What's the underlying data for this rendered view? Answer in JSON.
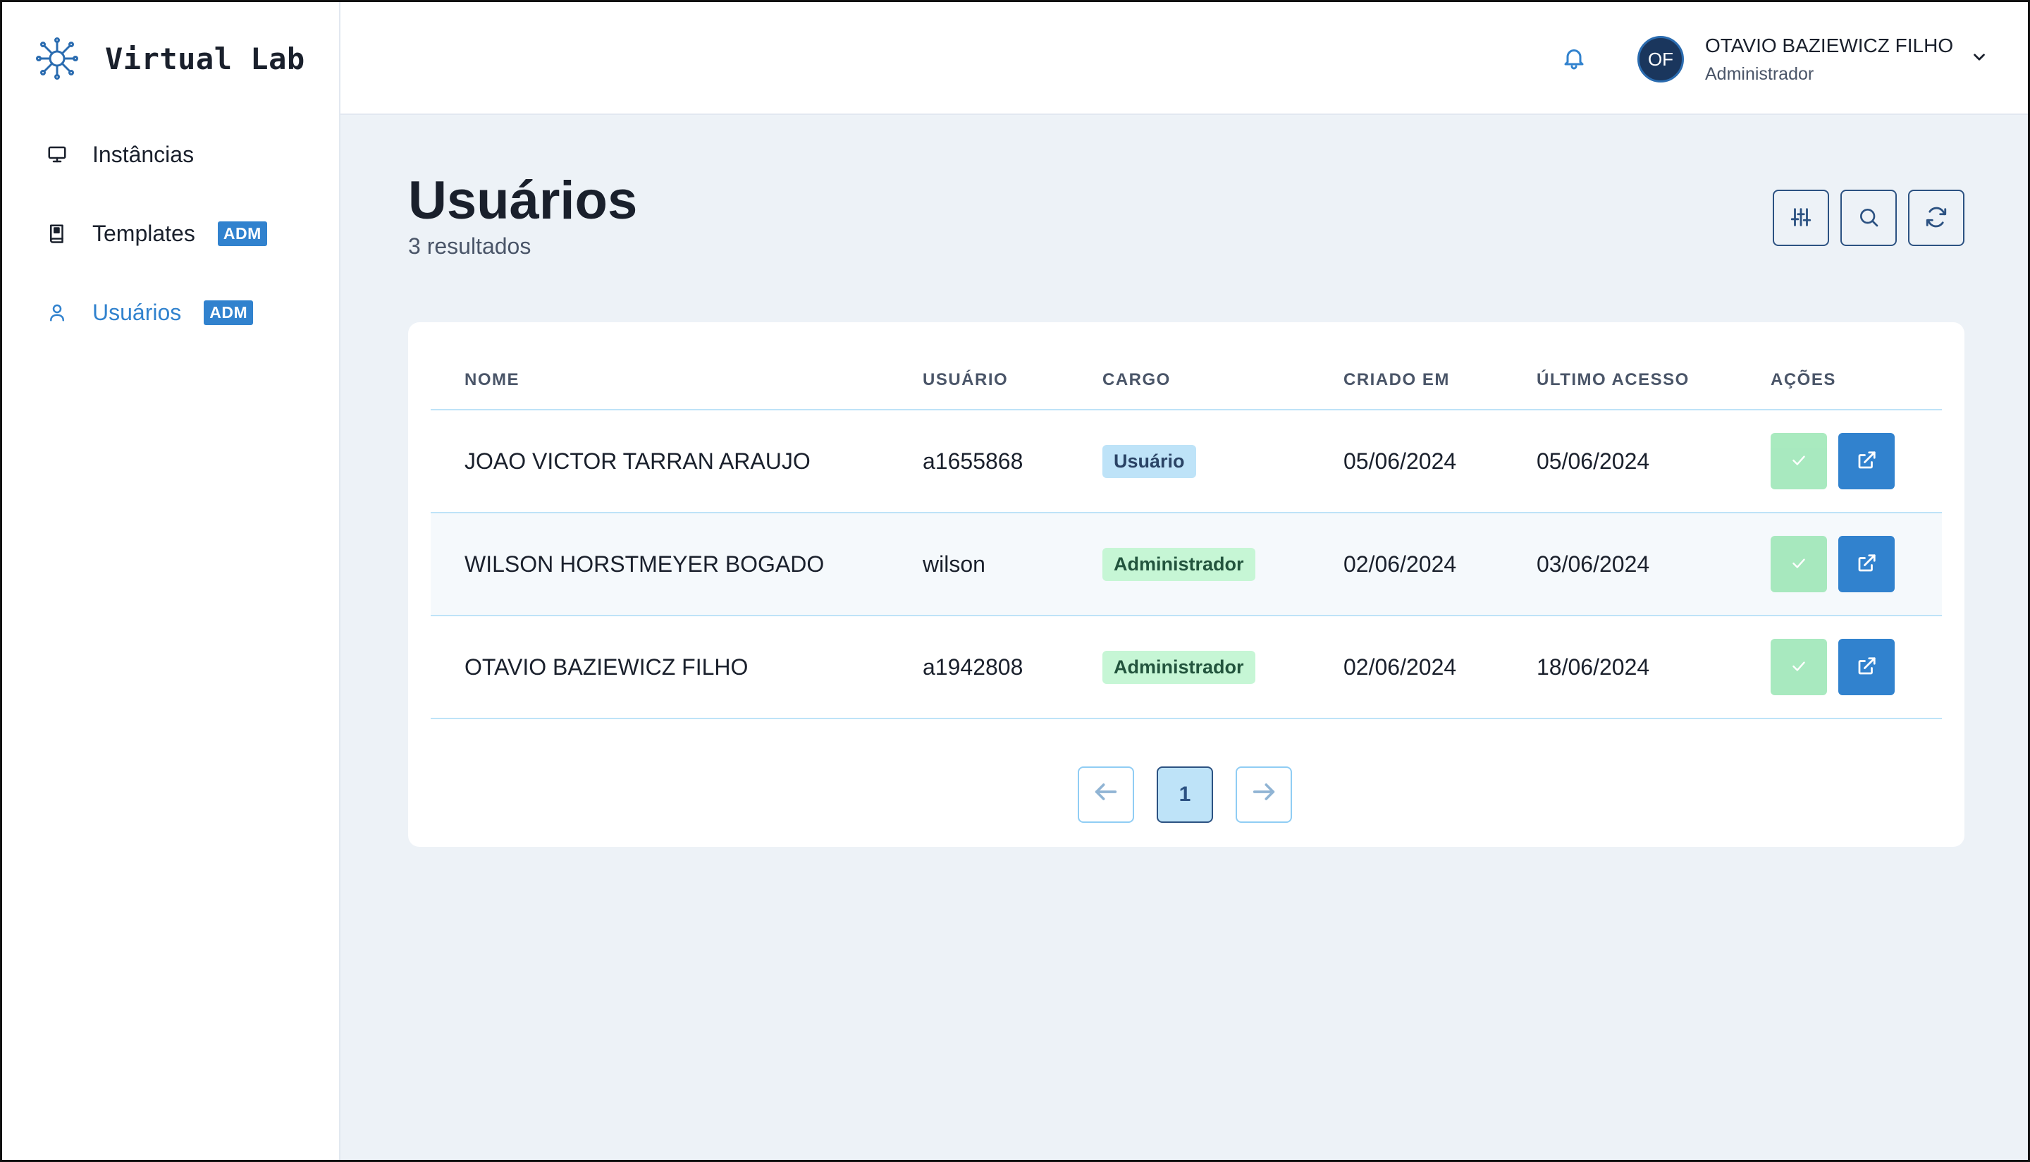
{
  "app": {
    "name": "Virtual Lab"
  },
  "sidebar": {
    "items": [
      {
        "label": "Instâncias",
        "icon": "monitor-icon",
        "badge": ""
      },
      {
        "label": "Templates",
        "icon": "book-icon",
        "badge": "ADM"
      },
      {
        "label": "Usuários",
        "icon": "user-icon",
        "badge": "ADM",
        "active": true
      }
    ]
  },
  "header": {
    "user": {
      "initials": "OF",
      "name": "OTAVIO BAZIEWICZ FILHO",
      "role": "Administrador"
    }
  },
  "page": {
    "title": "Usuários",
    "subtitle": "3 resultados"
  },
  "table": {
    "columns": [
      "NOME",
      "USUÁRIO",
      "CARGO",
      "CRIADO EM",
      "ÚLTIMO ACESSO",
      "AÇÕES"
    ],
    "rows": [
      {
        "nome": "JOAO VICTOR TARRAN ARAUJO",
        "usuario": "a1655868",
        "cargo": "Usuário",
        "criado": "05/06/2024",
        "acesso": "05/06/2024"
      },
      {
        "nome": "WILSON HORSTMEYER BOGADO",
        "usuario": "wilson",
        "cargo": "Administrador",
        "criado": "02/06/2024",
        "acesso": "03/06/2024"
      },
      {
        "nome": "OTAVIO BAZIEWICZ FILHO",
        "usuario": "a1942808",
        "cargo": "Administrador",
        "criado": "02/06/2024",
        "acesso": "18/06/2024"
      }
    ]
  },
  "pagination": {
    "current": "1"
  },
  "colors": {
    "accent": "#3182ce",
    "navy": "#2c5282",
    "success": "#9ae6b4",
    "background": "#edf2f7"
  }
}
